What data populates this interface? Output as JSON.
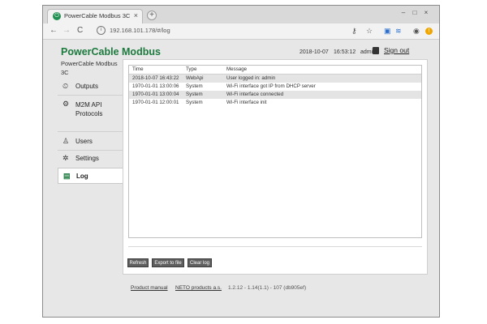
{
  "browser": {
    "tab_title": "PowerCable Modbus 3C",
    "tab_close": "×",
    "new_tab": "+",
    "url": "192.168.101.178/#/log",
    "nav_back": "←",
    "nav_forward": "→",
    "nav_reload": "C",
    "url_info": "i",
    "win_minimize": "–",
    "win_maximize": "□",
    "win_close": "×",
    "ext_key": "⚷",
    "ext_star": "☆",
    "ext_a": "▣",
    "ext_b": "≋",
    "ext_profile": "◉",
    "ext_alert": "!"
  },
  "header": {
    "brand": "PowerCable Modbus",
    "brand_sub": "PowerCable Modbus 3C",
    "date": "2018-10-07",
    "time": "16:53:12",
    "user": "admin",
    "sign_out": "Sign out"
  },
  "sidebar": {
    "items": [
      {
        "label": "Outputs",
        "icon": "⏲"
      },
      {
        "label": "M2M API Protocols",
        "icon": "⚙"
      },
      {
        "label": "Users",
        "icon": "♙"
      },
      {
        "label": "Settings",
        "icon": "✲"
      },
      {
        "label": "Log",
        "icon": "▤"
      }
    ]
  },
  "log": {
    "columns": [
      "Time",
      "Type",
      "Message"
    ],
    "rows": [
      {
        "time": "2018-10-07 16:43:22",
        "type": "WebApi",
        "message": "User logged in: admin"
      },
      {
        "time": "1970-01-01 13:00:06",
        "type": "System",
        "message": "Wi-Fi interface got IP from DHCP server"
      },
      {
        "time": "1970-01-01 13:00:04",
        "type": "System",
        "message": "Wi-Fi interface connected"
      },
      {
        "time": "1970-01-01 12:00:01",
        "type": "System",
        "message": "Wi-Fi interface init"
      }
    ]
  },
  "buttons": {
    "refresh": "Refresh",
    "export": "Export to file",
    "clear": "Clear log"
  },
  "footer": {
    "manual": "Product manual",
    "company": "NETO products a.s.",
    "version": "1.2.12 - 1.14(1.1) - 107 (db905ef)"
  },
  "colors": {
    "brand": "#1d7a3e",
    "button": "#5e5e5e"
  }
}
